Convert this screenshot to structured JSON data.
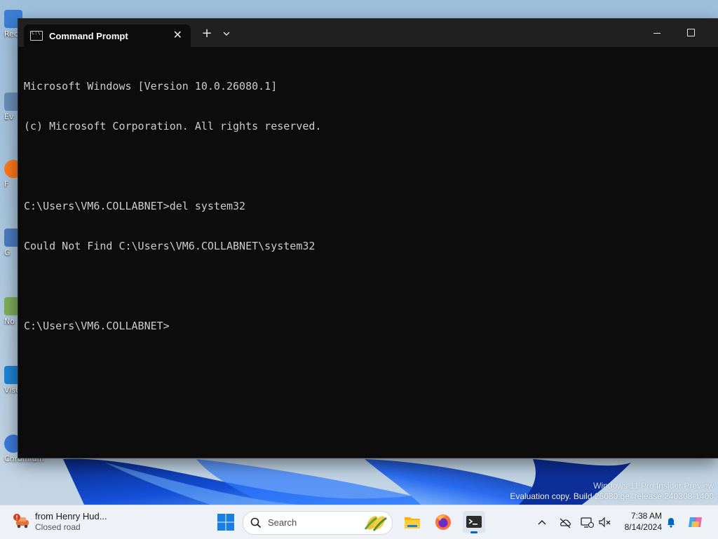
{
  "desktop": {
    "icons": [
      {
        "label": "Rec"
      },
      {
        "label": "Ev"
      },
      {
        "label": "F"
      },
      {
        "label": "G"
      },
      {
        "label": "No"
      },
      {
        "label": "Visu"
      },
      {
        "label": "Chromium"
      }
    ],
    "watermark": {
      "line1": "Windows 11 Pro Insider Preview",
      "line2": "Evaluation copy. Build 26080.ge_release.240308-1400"
    }
  },
  "window": {
    "tab_title": "Command Prompt",
    "tab_icon": "cmd-icon",
    "new_tab_label": "+",
    "close_tab_label": "✕",
    "console_lines": [
      "Microsoft Windows [Version 10.0.26080.1]",
      "(c) Microsoft Corporation. All rights reserved.",
      "",
      "C:\\Users\\VM6.COLLABNET>del system32",
      "Could Not Find C:\\Users\\VM6.COLLABNET\\system32",
      "",
      "C:\\Users\\VM6.COLLABNET>"
    ]
  },
  "taskbar": {
    "widget": {
      "title": "from Henry Hud...",
      "subtitle": "Closed road"
    },
    "search_label": "Search",
    "icons": [
      "windows-start-icon",
      "file-explorer-icon",
      "firefox-icon",
      "terminal-icon"
    ],
    "tray": {
      "time": "7:38 AM",
      "date": "8/14/2024"
    }
  },
  "colors": {
    "console_bg": "#0c0c0c",
    "console_text": "#cccccc",
    "titlebar": "#202020",
    "taskbar": "#eef1f6",
    "accent": "#0067c0"
  }
}
